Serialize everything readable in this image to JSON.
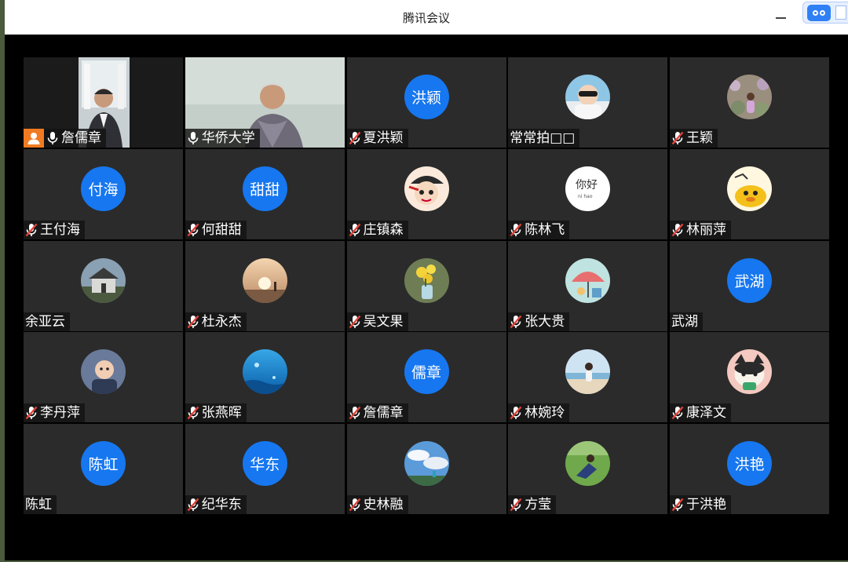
{
  "window": {
    "title": "腾讯会议"
  },
  "colors": {
    "accent": "#1677f0",
    "tile": "#2b2b2b",
    "active_speaker": "#37c25a",
    "host_badge": "#f07b22",
    "muted": "#e0433a"
  },
  "participants": [
    {
      "name": "詹儒章",
      "avatar_type": "video",
      "mic": "on",
      "host": true
    },
    {
      "name": "华侨大学",
      "avatar_type": "video",
      "mic": "on",
      "active": true
    },
    {
      "name": "夏洪颖",
      "avatar_type": "text",
      "avatar_text": "洪颖",
      "mic": "muted"
    },
    {
      "name": "常常拍□□",
      "avatar_type": "photo",
      "photo": "child-sunglasses",
      "mic": "none"
    },
    {
      "name": "王颖",
      "avatar_type": "photo",
      "photo": "woman-flowers",
      "mic": "muted"
    },
    {
      "name": "王付海",
      "avatar_type": "text",
      "avatar_text": "付海",
      "mic": "muted"
    },
    {
      "name": "何甜甜",
      "avatar_type": "text",
      "avatar_text": "甜甜",
      "mic": "muted"
    },
    {
      "name": "庄镇森",
      "avatar_type": "photo",
      "photo": "cartoon-pirate",
      "mic": "muted"
    },
    {
      "name": "陈林飞",
      "avatar_type": "photo",
      "photo": "calligraphy-nihao",
      "mic": "muted"
    },
    {
      "name": "林丽萍",
      "avatar_type": "photo",
      "photo": "cartoon-duck",
      "mic": "muted"
    },
    {
      "name": "余亚云",
      "avatar_type": "photo",
      "photo": "house",
      "mic": "none"
    },
    {
      "name": "杜永杰",
      "avatar_type": "photo",
      "photo": "sunset-figure",
      "mic": "muted"
    },
    {
      "name": "吴文果",
      "avatar_type": "photo",
      "photo": "yellow-flowers",
      "mic": "muted"
    },
    {
      "name": "张大贵",
      "avatar_type": "photo",
      "photo": "painting-umbrella",
      "mic": "muted"
    },
    {
      "name": "武湖",
      "avatar_type": "text",
      "avatar_text": "武湖",
      "mic": "none"
    },
    {
      "name": "李丹萍",
      "avatar_type": "photo",
      "photo": "baby",
      "mic": "muted"
    },
    {
      "name": "张燕晖",
      "avatar_type": "photo",
      "photo": "ocean-blue",
      "mic": "muted"
    },
    {
      "name": "詹儒章",
      "avatar_type": "text",
      "avatar_text": "儒章",
      "mic": "muted"
    },
    {
      "name": "林婉玲",
      "avatar_type": "photo",
      "photo": "beach-girl",
      "mic": "muted"
    },
    {
      "name": "康泽文",
      "avatar_type": "photo",
      "photo": "cartoon-cat",
      "mic": "muted"
    },
    {
      "name": "陈虹",
      "avatar_type": "text",
      "avatar_text": "陈虹",
      "mic": "none"
    },
    {
      "name": "纪华东",
      "avatar_type": "text",
      "avatar_text": "华东",
      "mic": "muted"
    },
    {
      "name": "史林融",
      "avatar_type": "photo",
      "photo": "sky-clouds",
      "mic": "muted"
    },
    {
      "name": "方莹",
      "avatar_type": "photo",
      "photo": "grass-person",
      "mic": "muted"
    },
    {
      "name": "于洪艳",
      "avatar_type": "text",
      "avatar_text": "洪艳",
      "mic": "muted"
    }
  ]
}
